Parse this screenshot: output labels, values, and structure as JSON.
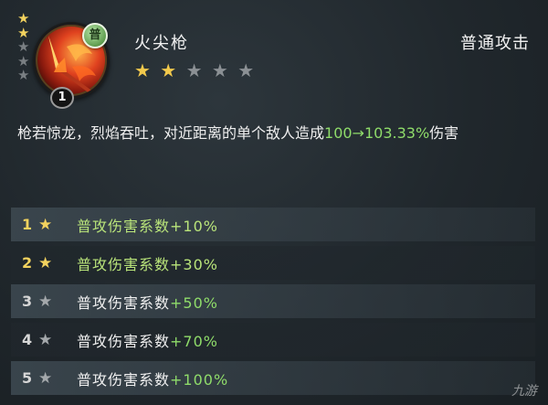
{
  "skill": {
    "name": "火尖枪",
    "type": "普通攻击",
    "grade_badge": "普",
    "level": "1",
    "tier_stars": {
      "filled": 2,
      "total": 5
    },
    "rating": {
      "filled": 2,
      "total": 5
    },
    "icon": "fire-spear-icon",
    "description_prefix": "枪若惊龙，烈焰吞吐，对近距离的单个敌人造成",
    "description_value": "100→103.33%",
    "description_suffix": "伤害"
  },
  "upgrades": [
    {
      "num": "1",
      "label": "普攻伤害系数",
      "value": "+10%",
      "active": true
    },
    {
      "num": "2",
      "label": "普攻伤害系数",
      "value": "+30%",
      "active": true
    },
    {
      "num": "3",
      "label": "普攻伤害系数",
      "value": "+50%",
      "active": false
    },
    {
      "num": "4",
      "label": "普攻伤害系数",
      "value": "+70%",
      "active": false
    },
    {
      "num": "5",
      "label": "普攻伤害系数",
      "value": "+100%",
      "active": false
    }
  ],
  "watermark": "九游",
  "colors": {
    "gold": "#f2d25e",
    "green": "#8fdc6a",
    "inactive_star": "#8b9094"
  }
}
